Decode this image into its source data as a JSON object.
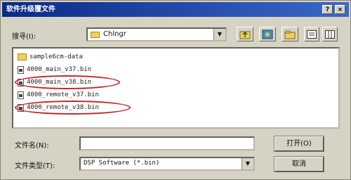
{
  "dialog": {
    "title": "软件升级覆文件",
    "help_btn": "?",
    "close_btn": "×"
  },
  "toolbar": {
    "look_in_label": "搜寻(I):",
    "folder_value": "Chlngr",
    "drop_glyph": "▼"
  },
  "files": [
    {
      "name": "sample6cm-data",
      "type": "folder"
    },
    {
      "name": "4000_main_v37.bin",
      "type": "file"
    },
    {
      "name": "4000_main_v38.bin",
      "type": "file",
      "highlighted": true
    },
    {
      "name": "4000_remote_v37.bin",
      "type": "file"
    },
    {
      "name": "4000_remote_v38.bin",
      "type": "file",
      "highlighted": true
    }
  ],
  "form": {
    "filename_label": "文件名(N):",
    "filename_value": "",
    "filetype_label": "文件类型(T):",
    "filetype_value": "DSP Software (*.bin)",
    "open_button": "打开(O)",
    "cancel_button": "取消"
  },
  "colors": {
    "highlight_circle": "#c4232a",
    "title_bar": "#0b2a86"
  }
}
